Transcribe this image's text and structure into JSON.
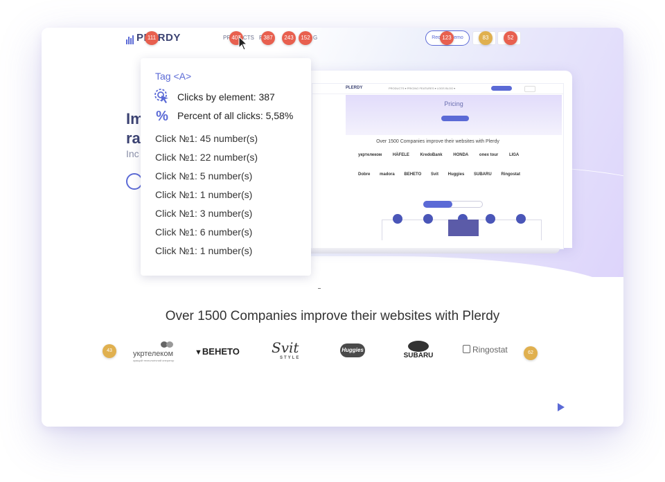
{
  "nav": {
    "logo": "PLERDY",
    "item_products": "PRODUCTS",
    "item_pricing": "P",
    "item_blog": "G",
    "demo_button": "Request demo"
  },
  "badges": {
    "logo_count": "111",
    "products_count": "407",
    "pricing_count": "387",
    "features_count": "243",
    "blog_count": "152",
    "demo_count": "123",
    "box1_count": "83",
    "box2_count": "52",
    "logo_left_count": "43",
    "logo_right_count": "62"
  },
  "hero": {
    "line1": "Im",
    "line2": "ra",
    "sub": "Inc"
  },
  "popup": {
    "tag": "Tag <A>",
    "clicks_by_element": "Clicks by element: 387",
    "percent": "Percent of all clicks: 5,58%",
    "clicks": [
      "Click №1: 45 number(s)",
      "Click №1: 22 number(s)",
      "Click №1: 5 number(s)",
      "Click №1: 1 number(s)",
      "Click №1: 3 number(s)",
      "Click №1: 6 number(s)",
      "Click №1: 1 number(s)"
    ]
  },
  "screen": {
    "logo": "PLERDY",
    "menu": "PRODUCTS ▾   PRICING   FEATURES ▾   LOGS   BLOG ▾",
    "pricing": "Pricing",
    "over": "Over 1500 Companies improve their websites with Plerdy",
    "row1": [
      "укртелеком",
      "HÄFELE",
      "KredoBank",
      "HONDA",
      "onex tour",
      "LIGA"
    ],
    "row2": [
      "Dobre",
      "madora",
      "BEHETO",
      "Svit",
      "Huggies",
      "SUBARU",
      "Ringostat"
    ]
  },
  "companies": {
    "title": "Over 1500 Companies improve their websites with Plerdy",
    "logos": [
      "укртелеком",
      "BEHETO",
      "Svit",
      "Huggies",
      "SUBARU",
      "Ringostat"
    ],
    "svit_sub": "STYLE",
    "ukr_sub": "кращий технологічний оператор"
  }
}
